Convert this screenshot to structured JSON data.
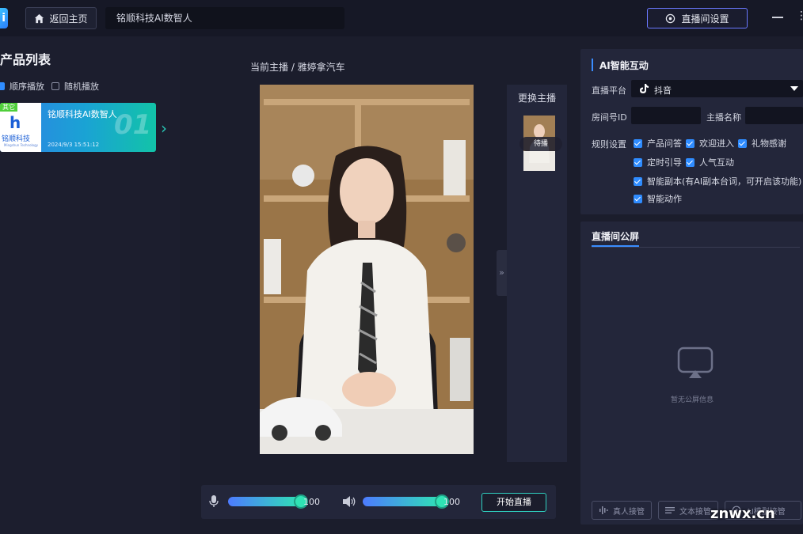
{
  "topbar": {
    "logo_letter": "i",
    "home_label": "返回主页",
    "title_value": "铭顺科技AI数智人",
    "room_settings_label": "直播间设置"
  },
  "product_list": {
    "title": "产品列表",
    "modes": [
      {
        "label": "顺序播放",
        "checked": true
      },
      {
        "label": "随机播放",
        "checked": false
      }
    ],
    "items": [
      {
        "tag": "其它",
        "logo_text": "铭顺科技",
        "logo_subtext": "Mingshun Technology",
        "name": "铭顺科技AI数智人",
        "date": "2024/9/3 15:51:12",
        "index": "01"
      }
    ],
    "next_arrow": "›"
  },
  "stage": {
    "current_anchor": "当前主播 / 雅婷拿汽车",
    "switch_title": "更换主播",
    "anchor_status": "待播",
    "collapse_glyph": "»"
  },
  "controls": {
    "mic_volume": 100,
    "speaker_volume": 100,
    "mic_level": 1.0,
    "speaker_level": 1.0,
    "start_label": "开始直播"
  },
  "ai_panel": {
    "title": "AI智能互动",
    "platform_label": "直播平台",
    "platform_value": "抖音",
    "room_id_label": "房间号ID",
    "room_id_value": "",
    "host_name_label": "主播名称",
    "host_name_value": "",
    "rules_label": "规则设置",
    "rules": [
      {
        "label": "产品问答",
        "checked": true
      },
      {
        "label": "欢迎进入",
        "checked": true
      },
      {
        "label": "礼物感谢",
        "checked": true
      },
      {
        "label": "定时引导",
        "checked": true
      },
      {
        "label": "人气互动",
        "checked": true
      },
      {
        "label": "智能副本(有AI副本台词，可开启该功能)",
        "checked": true
      },
      {
        "label": "智能动作",
        "checked": true
      }
    ]
  },
  "screen_panel": {
    "title": "直播间公屏",
    "empty_text": "暂无公屏信息",
    "buttons": [
      "真人接管",
      "文本接管",
      "AI模型接管"
    ]
  },
  "watermark": "znwx.cn",
  "colors": {
    "accent_blue": "#2f8cff",
    "accent_teal": "#2fe3b4",
    "panel_bg": "#23263a",
    "page_bg": "#1b1d2c"
  }
}
